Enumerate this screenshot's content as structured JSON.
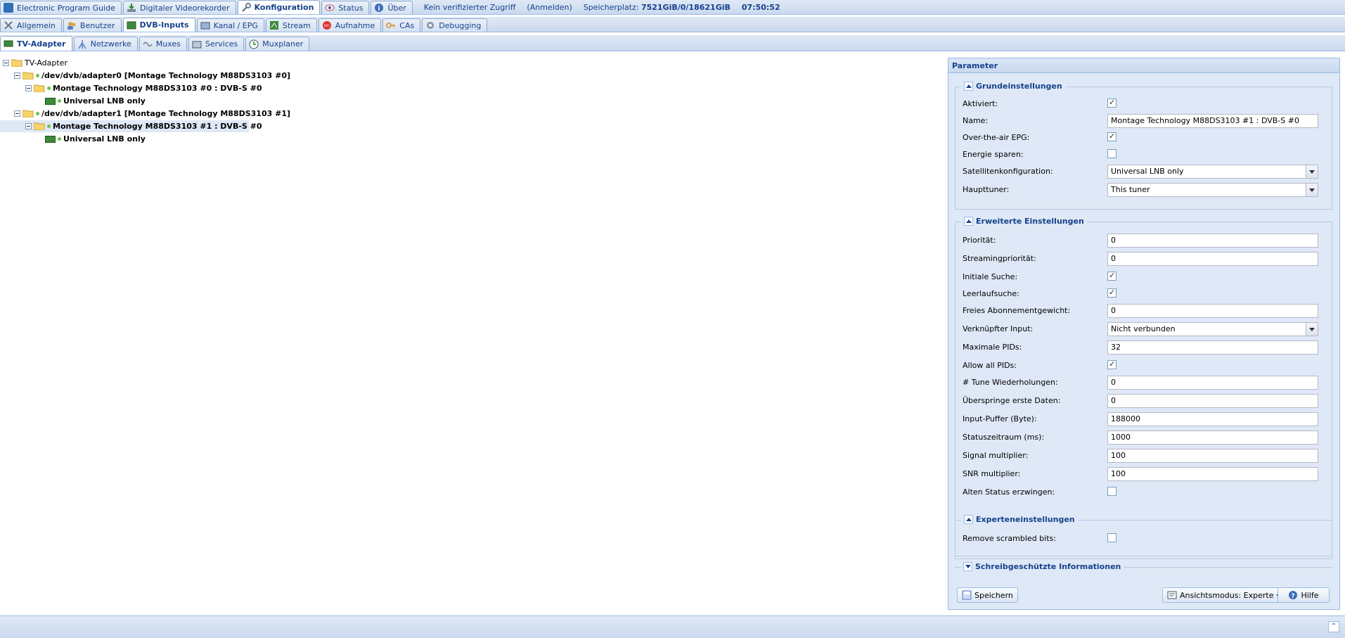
{
  "top_tabs": [
    {
      "label": "Electronic Program Guide",
      "icon": "epg-icon"
    },
    {
      "label": "Digitaler Videorekorder",
      "icon": "download-icon"
    },
    {
      "label": "Konfiguration",
      "icon": "wrench-icon",
      "active": true
    },
    {
      "label": "Status",
      "icon": "eye-icon"
    },
    {
      "label": "Über",
      "icon": "info-icon"
    }
  ],
  "status": {
    "access": "Kein verifizierter Zugriff",
    "login": "(Anmelden)",
    "storage_label": "Speicherplatz:",
    "storage_value": "7521GiB/0/18621GiB",
    "time": "07:50:52"
  },
  "config_tabs": [
    {
      "label": "Allgemein",
      "icon": "tools-icon"
    },
    {
      "label": "Benutzer",
      "icon": "users-icon"
    },
    {
      "label": "DVB-Inputs",
      "icon": "card-icon",
      "active": true
    },
    {
      "label": "Kanal / EPG",
      "icon": "tv-icon"
    },
    {
      "label": "Stream",
      "icon": "stream-icon"
    },
    {
      "label": "Aufnahme",
      "icon": "rec-icon"
    },
    {
      "label": "CAs",
      "icon": "key-icon"
    },
    {
      "label": "Debugging",
      "icon": "gear-icon"
    }
  ],
  "dvb_tabs": [
    {
      "label": "TV-Adapter",
      "icon": "tv-adapter-icon",
      "active": true
    },
    {
      "label": "Netzwerke",
      "icon": "network-icon"
    },
    {
      "label": "Muxes",
      "icon": "mux-icon"
    },
    {
      "label": "Services",
      "icon": "services-icon"
    },
    {
      "label": "Muxplaner",
      "icon": "clock-icon"
    }
  ],
  "tree": {
    "root": "TV-Adapter",
    "adapter0": "/dev/dvb/adapter0 [Montage Technology M88DS3103 #0]",
    "frontend0": "Montage Technology M88DS3103 #0 : DVB-S #0",
    "lnb0": "Universal LNB only",
    "adapter1": "/dev/dvb/adapter1 [Montage Technology M88DS3103 #1]",
    "frontend1": "Montage Technology M88DS3103 #1 : DVB-S #0",
    "lnb1": "Universal LNB only"
  },
  "panel": {
    "title": "Parameter",
    "basic": {
      "title": "Grundeinstellungen",
      "enabled_label": "Aktiviert:",
      "enabled": true,
      "name_label": "Name:",
      "name": "Montage Technology M88DS3103 #1 : DVB-S #0",
      "epg_label": "Over-the-air EPG:",
      "epg": true,
      "power_label": "Energie sparen:",
      "power": false,
      "satconf_label": "Satellitenkonfiguration:",
      "satconf": "Universal LNB only",
      "master_label": "Haupttuner:",
      "master": "This tuner"
    },
    "advanced": {
      "title": "Erweiterte Einstellungen",
      "priority_label": "Priorität:",
      "priority": "0",
      "spriority_label": "Streamingpriorität:",
      "spriority": "0",
      "initscan_label": "Initiale Suche:",
      "initscan": true,
      "idlescan_label": "Leerlaufsuche:",
      "idlescan": true,
      "weight_label": "Freies Abonnementgewicht:",
      "weight": "0",
      "linked_label": "Verknüpfter Input:",
      "linked": "Nicht verbunden",
      "maxpids_label": "Maximale PIDs:",
      "maxpids": "32",
      "allpids_label": "Allow all PIDs:",
      "allpids": true,
      "retries_label": "# Tune Wiederholungen:",
      "retries": "0",
      "skip_label": "Überspringe erste Daten:",
      "skip": "0",
      "buffer_label": "Input-Puffer (Byte):",
      "buffer": "188000",
      "status_label": "Statuszeitraum (ms):",
      "status": "1000",
      "signal_label": "Signal multiplier:",
      "signal": "100",
      "snr_label": "SNR multiplier:",
      "snr": "100",
      "oldstatus_label": "Alten Status erzwingen:",
      "oldstatus": false
    },
    "expert": {
      "title": "Experteneinstellungen",
      "scrambled_label": "Remove scrambled bits:",
      "scrambled": false
    },
    "readonly_title": "Schreibgeschützte Informationen",
    "save_label": "Speichern",
    "view_label": "Ansichtsmodus: Experte",
    "help_label": "Hilfe"
  }
}
